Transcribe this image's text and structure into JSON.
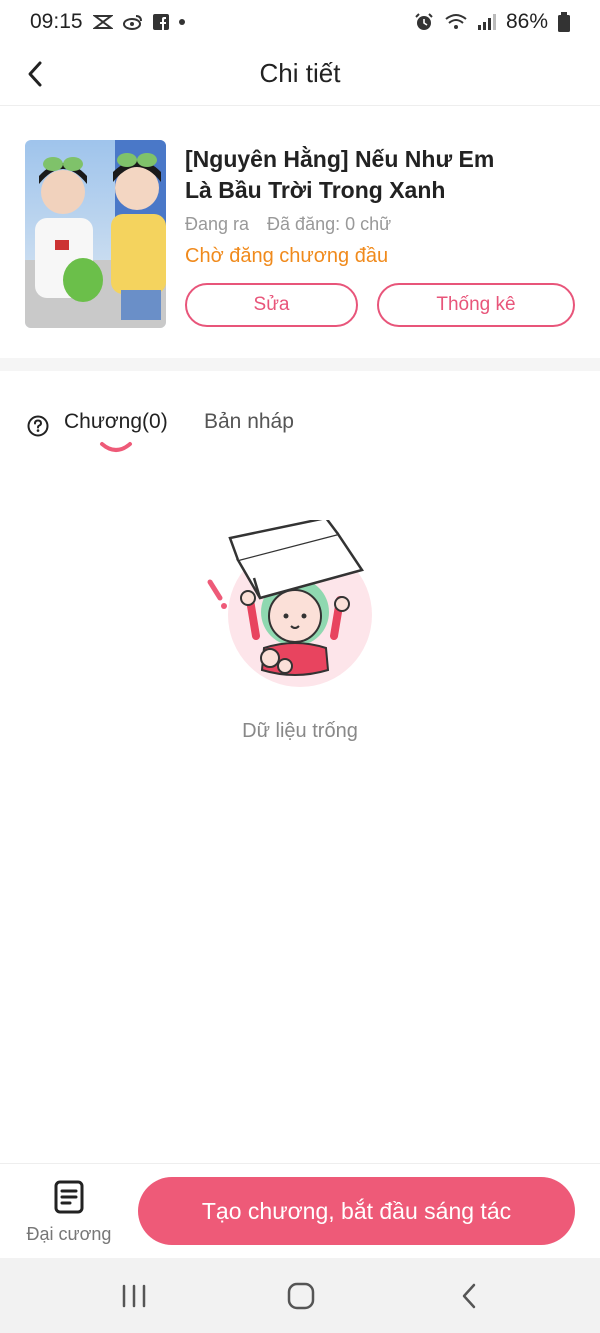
{
  "status_bar": {
    "time": "09:15",
    "battery": "86%",
    "icons_left": [
      "capcut-icon",
      "weibo-icon",
      "facebook-icon",
      "notification-dot"
    ],
    "icons_right": [
      "alarm-icon",
      "wifi-icon",
      "signal-icon",
      "battery-icon"
    ]
  },
  "header": {
    "title": "Chi tiết"
  },
  "book": {
    "title_line1": "[Nguyên Hằng] Nếu Như Em",
    "title_line2": "Là Bầu Trời Trong Xanh",
    "status": "Đang ra",
    "posted": "Đã đăng: 0 chữ",
    "pending": "Chờ đăng chương đầu",
    "edit_label": "Sửa",
    "stats_label": "Thống kê"
  },
  "tabs": {
    "chapters": "Chương(0)",
    "drafts": "Bản nháp"
  },
  "empty": {
    "text": "Dữ liệu trống"
  },
  "bottom": {
    "outline_label": "Đại cương",
    "create_label": "Tạo chương, bắt đầu sáng tác"
  },
  "colors": {
    "accent": "#ee5a78",
    "pending": "#f08a1c",
    "muted": "#999999"
  }
}
